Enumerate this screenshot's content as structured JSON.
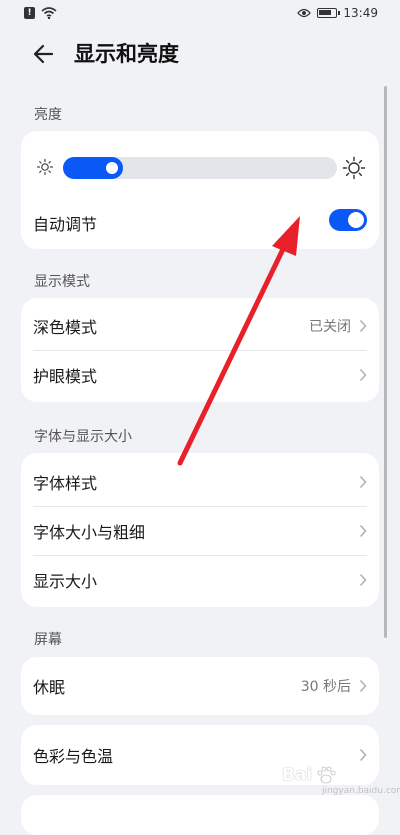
{
  "status_bar": {
    "time": "13:49"
  },
  "header": {
    "title": "显示和亮度"
  },
  "brightness": {
    "section_title": "亮度",
    "level": 0.22,
    "auto_adjust_label": "自动调节",
    "auto_adjust_on": true
  },
  "display_mode": {
    "section_title": "显示模式",
    "items": [
      {
        "label": "深色模式",
        "value": "已关闭"
      },
      {
        "label": "护眼模式",
        "value": ""
      }
    ]
  },
  "font_size": {
    "section_title": "字体与显示大小",
    "items": [
      {
        "label": "字体样式"
      },
      {
        "label": "字体大小与粗细"
      },
      {
        "label": "显示大小"
      }
    ]
  },
  "screen": {
    "section_title": "屏幕",
    "sleep": {
      "label": "休眠",
      "value": "30 秒后"
    },
    "color_temp": {
      "label": "色彩与色温"
    }
  },
  "watermark": {
    "text": "Bai",
    "sub": "jingyan.baidu.com"
  },
  "colors": {
    "accent": "#0a59f7",
    "annotation": "#e8202a"
  },
  "icons": [
    "back-arrow-icon",
    "sun-dim-icon",
    "sun-bright-icon",
    "chevron-right-icon",
    "eye-icon",
    "wifi-icon",
    "battery-icon"
  ]
}
